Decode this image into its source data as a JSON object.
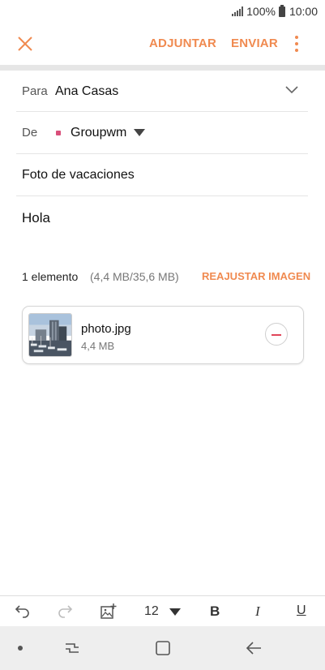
{
  "status_bar": {
    "battery_percent": "100%",
    "time": "10:00"
  },
  "app_bar": {
    "attach_label": "ADJUNTAR",
    "send_label": "ENVIAR"
  },
  "compose": {
    "to_label": "Para",
    "to_value": "Ana Casas",
    "from_label": "De",
    "from_value": "Groupwm",
    "subject": "Foto de vacaciones",
    "body": "Hola"
  },
  "attachments": {
    "count_label": "1 elemento",
    "size_info": "(4,4 MB/35,6 MB)",
    "resize_label": "REAJUSTAR IMAGEN",
    "files": [
      {
        "name": "photo.jpg",
        "size": "4,4 MB"
      }
    ]
  },
  "format_toolbar": {
    "font_size": "12",
    "bold_label": "B",
    "italic_label": "I",
    "underline_label": "U"
  },
  "colors": {
    "accent": "#f08a50",
    "remove": "#e0465a",
    "sender_dot": "#d94f7a"
  },
  "icons": [
    "close-icon",
    "more-vert-icon",
    "chevron-down-icon",
    "undo-icon",
    "redo-icon",
    "insert-image-icon",
    "recent-apps-icon",
    "home-icon",
    "back-icon"
  ]
}
